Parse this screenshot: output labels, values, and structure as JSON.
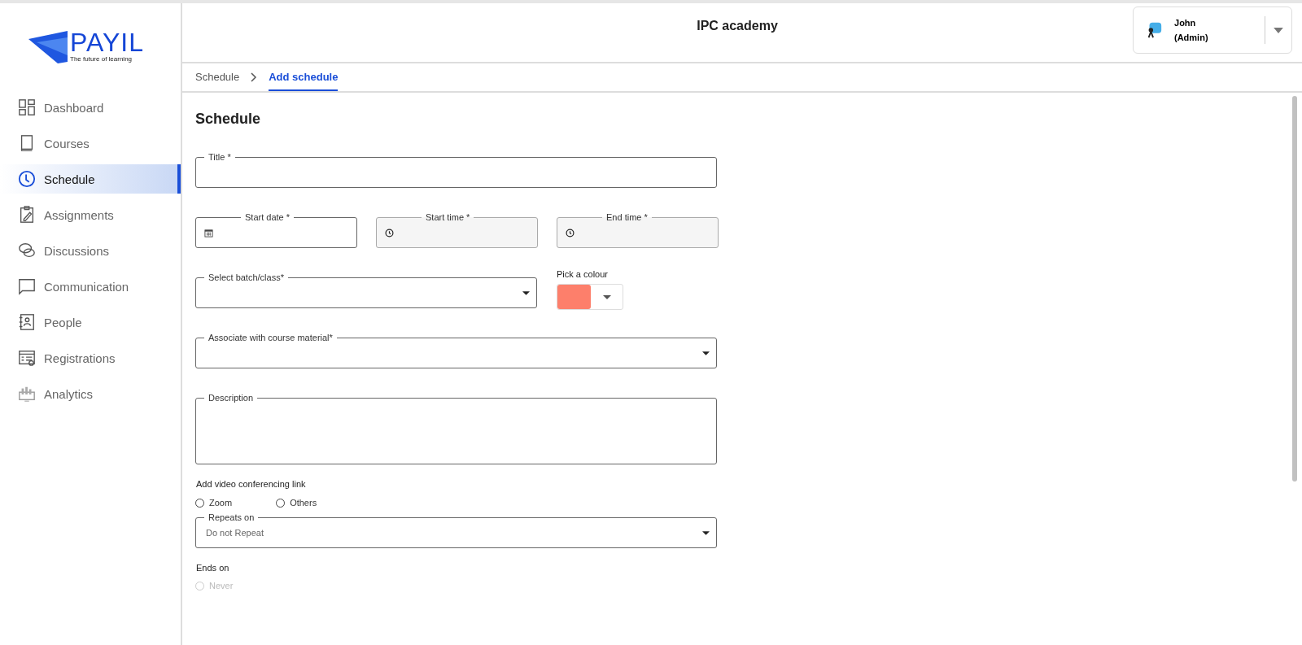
{
  "logo": {
    "name": "PAYIL",
    "tagline": "The future of learning"
  },
  "header": {
    "title": "IPC academy",
    "user": {
      "name": "John",
      "role": "(Admin)"
    }
  },
  "sidebar": {
    "items": [
      {
        "label": "Dashboard",
        "selected": false
      },
      {
        "label": "Courses",
        "selected": false
      },
      {
        "label": "Schedule",
        "selected": true
      },
      {
        "label": "Assignments",
        "selected": false
      },
      {
        "label": "Discussions",
        "selected": false
      },
      {
        "label": "Communication",
        "selected": false
      },
      {
        "label": "People",
        "selected": false
      },
      {
        "label": "Registrations",
        "selected": false
      },
      {
        "label": "Analytics",
        "selected": false
      }
    ]
  },
  "breadcrumb": [
    {
      "label": "Schedule",
      "selected": false
    },
    {
      "label": "Add schedule",
      "selected": true
    }
  ],
  "form": {
    "heading": "Schedule",
    "title_field": {
      "label": "Title *"
    },
    "datetime_fields": [
      {
        "label": "Start date *",
        "kind": "date",
        "disabled": false
      },
      {
        "label": "Start time *",
        "kind": "time",
        "disabled": true
      },
      {
        "label": "End time *",
        "kind": "time",
        "disabled": true
      }
    ],
    "batch_field": {
      "label": "Select batch/class*"
    },
    "colour_picker": {
      "label": "Pick a colour",
      "color": "#fd7f6b"
    },
    "material_field": {
      "label": "Associate with course material*"
    },
    "description_field": {
      "label": "Description"
    },
    "video_link": {
      "label": "Add video conferencing link",
      "options": [
        {
          "label": "Zoom",
          "selected": false
        },
        {
          "label": "Others",
          "selected": false
        }
      ]
    },
    "repeats_field": {
      "label": "Repeats on",
      "value": "Do not Repeat"
    },
    "ends_on": {
      "label": "Ends on",
      "options": [
        {
          "label": "Never",
          "selected": false,
          "disabled": true
        }
      ]
    }
  }
}
